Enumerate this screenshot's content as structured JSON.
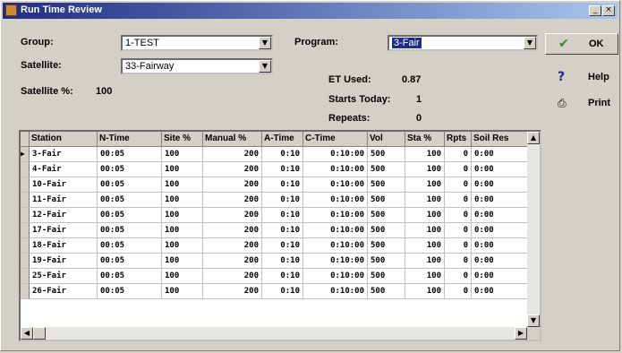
{
  "window": {
    "title": "Run Time Review"
  },
  "form": {
    "group_label": "Group:",
    "group_value": "1-TEST",
    "program_label": "Program:",
    "program_value": "3-Fair",
    "satellite_label": "Satellite:",
    "satellite_value": "33-Fairway",
    "satellite_pct_label": "Satellite %:",
    "satellite_pct_value": "100",
    "et_used_label": "ET Used:",
    "et_used_value": "0.87",
    "starts_today_label": "Starts Today:",
    "starts_today_value": "1",
    "repeats_label": "Repeats:",
    "repeats_value": "0"
  },
  "buttons": {
    "ok": "OK",
    "help": "Help",
    "print": "Print"
  },
  "table": {
    "columns": [
      "Station",
      "N-Time",
      "Site %",
      "Manual %",
      "A-Time",
      "C-Time",
      "Vol",
      "Sta %",
      "Rpts",
      "Soil Res"
    ],
    "rows": [
      [
        "3-Fair",
        "00:05",
        "100",
        "200",
        "0:10",
        "0:10:00",
        "500",
        "100",
        "0",
        "0:00"
      ],
      [
        "4-Fair",
        "00:05",
        "100",
        "200",
        "0:10",
        "0:10:00",
        "500",
        "100",
        "0",
        "0:00"
      ],
      [
        "10-Fair",
        "00:05",
        "100",
        "200",
        "0:10",
        "0:10:00",
        "500",
        "100",
        "0",
        "0:00"
      ],
      [
        "11-Fair",
        "00:05",
        "100",
        "200",
        "0:10",
        "0:10:00",
        "500",
        "100",
        "0",
        "0:00"
      ],
      [
        "12-Fair",
        "00:05",
        "100",
        "200",
        "0:10",
        "0:10:00",
        "500",
        "100",
        "0",
        "0:00"
      ],
      [
        "17-Fair",
        "00:05",
        "100",
        "200",
        "0:10",
        "0:10:00",
        "500",
        "100",
        "0",
        "0:00"
      ],
      [
        "18-Fair",
        "00:05",
        "100",
        "200",
        "0:10",
        "0:10:00",
        "500",
        "100",
        "0",
        "0:00"
      ],
      [
        "19-Fair",
        "00:05",
        "100",
        "200",
        "0:10",
        "0:10:00",
        "500",
        "100",
        "0",
        "0:00"
      ],
      [
        "25-Fair",
        "00:05",
        "100",
        "200",
        "0:10",
        "0:10:00",
        "500",
        "100",
        "0",
        "0:00"
      ],
      [
        "26-Fair",
        "00:05",
        "100",
        "200",
        "0:10",
        "0:10:00",
        "500",
        "100",
        "0",
        "0:00"
      ]
    ]
  },
  "colors": {
    "title_bar": "#1f2c85",
    "selection": "#1f2c85",
    "ok_check": "#2e8b2e",
    "help_mark": "#1f2c85"
  }
}
